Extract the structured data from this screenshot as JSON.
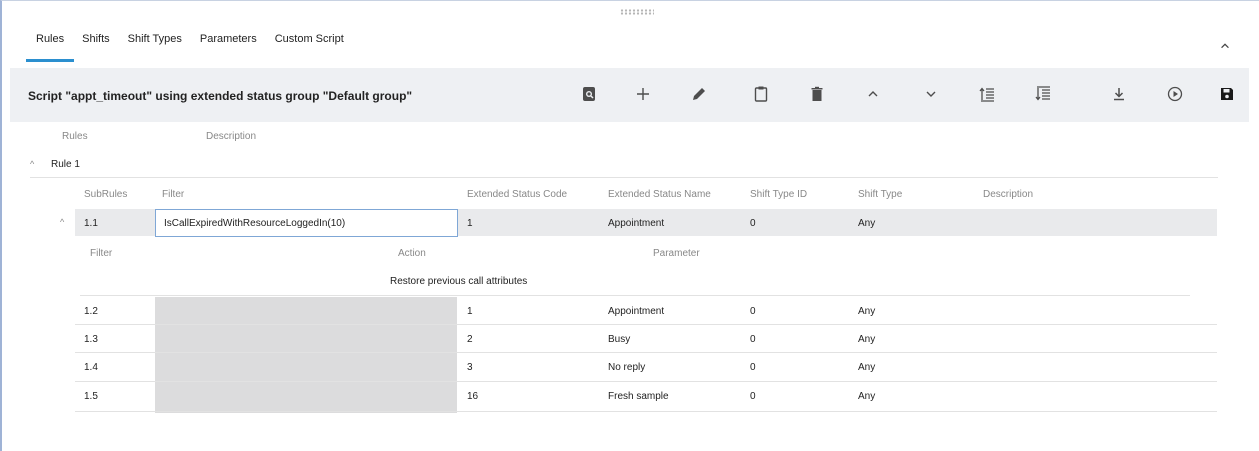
{
  "tabs": [
    "Rules",
    "Shifts",
    "Shift Types",
    "Parameters",
    "Custom Script"
  ],
  "toolbar": {
    "title": "Script \"appt_timeout\" using extended status group \"Default group\"",
    "icons": [
      "preview-icon",
      "add-icon",
      "edit-icon",
      "paste-icon",
      "delete-icon",
      "move-up-icon",
      "move-down-icon",
      "move-top-icon",
      "move-bottom-icon",
      "download-icon",
      "run-icon",
      "save-icon"
    ]
  },
  "rules_header": {
    "rules": "Rules",
    "description": "Description"
  },
  "rule": {
    "name": "Rule 1"
  },
  "subrule_headers": [
    "SubRules",
    "Filter",
    "Extended Status Code",
    "Extended Status Name",
    "Shift Type ID",
    "Shift Type",
    "Description"
  ],
  "action_headers": {
    "filter": "Filter",
    "action": "Action",
    "parameter": "Parameter"
  },
  "action_row": {
    "action": "Restore previous call attributes"
  },
  "subrules": [
    {
      "id": "1.1",
      "filter": "IsCallExpiredWithResourceLoggedIn(10)",
      "code": "1",
      "name": "Appointment",
      "shift_type_id": "0",
      "shift_type": "Any"
    },
    {
      "id": "1.2",
      "filter": "",
      "code": "1",
      "name": "Appointment",
      "shift_type_id": "0",
      "shift_type": "Any"
    },
    {
      "id": "1.3",
      "filter": "",
      "code": "2",
      "name": "Busy",
      "shift_type_id": "0",
      "shift_type": "Any"
    },
    {
      "id": "1.4",
      "filter": "",
      "code": "3",
      "name": "No reply",
      "shift_type_id": "0",
      "shift_type": "Any"
    },
    {
      "id": "1.5",
      "filter": "",
      "code": "16",
      "name": "Fresh sample",
      "shift_type_id": "0",
      "shift_type": "Any"
    }
  ],
  "colors": {
    "accent": "#2b8fcf",
    "toolbar_bg": "#eef0f3",
    "selected_row": "#e9eaec",
    "disabled_filter": "#dcdcdd"
  }
}
